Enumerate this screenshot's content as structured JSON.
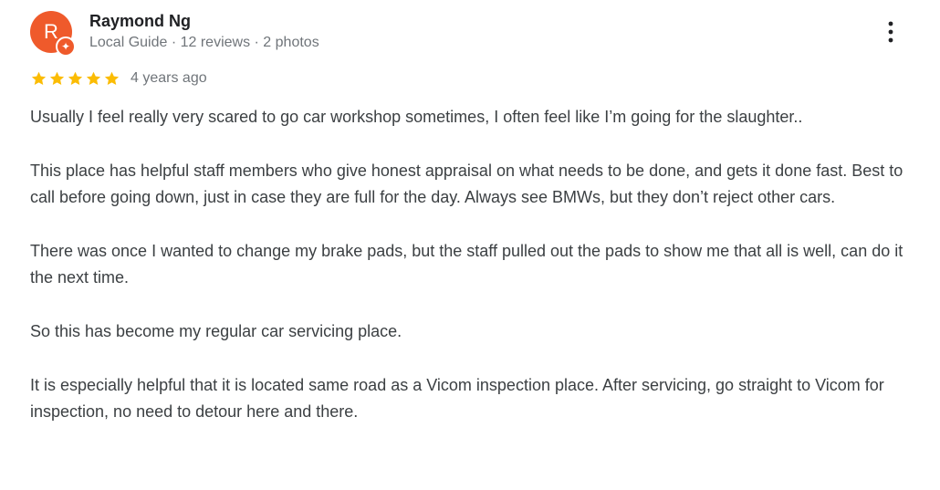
{
  "review": {
    "reviewer": {
      "avatar_initial": "R",
      "name": "Raymond Ng",
      "meta": "Local Guide · 12 reviews · 2 photos",
      "avatar_color": "#ef5a2b",
      "badge_icon": "local-guide-badge-icon"
    },
    "rating": {
      "stars": 5,
      "max_stars": 5,
      "star_color": "#fbbc04",
      "date": "4 years ago"
    },
    "paragraphs": [
      "Usually I feel really very scared to go car workshop sometimes, I often feel like I’m going for the slaughter..",
      "This place has helpful staff members who give honest appraisal on what needs to be done, and gets it done fast. Best to call before going down, just in case they are full for the day. Always see BMWs, but they don’t reject other cars.",
      "There was once I wanted to change my brake pads, but the staff pulled out the pads to show me that all is well, can do it the next time.",
      "So this has become my regular car servicing place.",
      "It is especially helpful that it is located same road as a Vicom inspection place. After servicing, go straight to Vicom for inspection, no need to detour here and there."
    ],
    "actions": {
      "more_icon": "more-vert-icon"
    }
  }
}
